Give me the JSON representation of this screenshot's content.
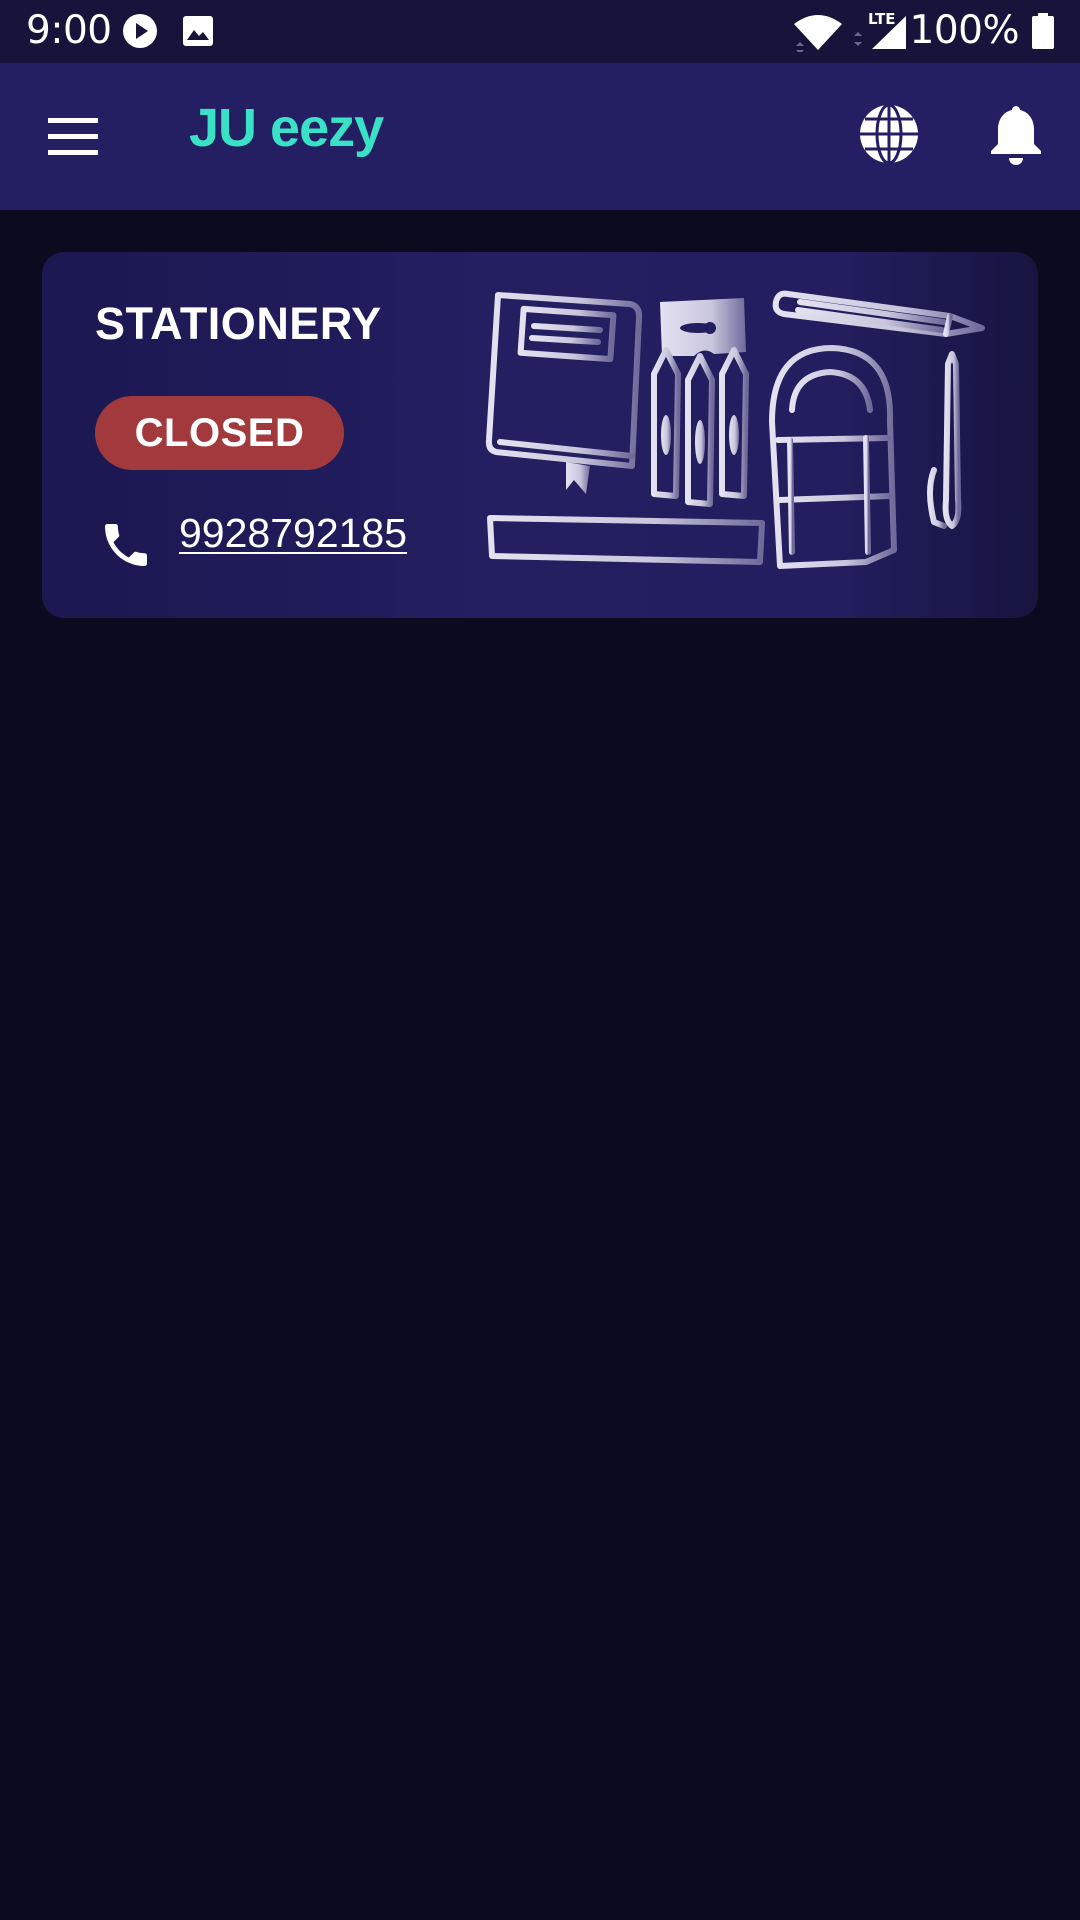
{
  "status_bar": {
    "time": "9:00",
    "battery": "100%",
    "network_label": "LTE",
    "icons": [
      "play-icon",
      "image-icon",
      "wifi-icon",
      "signal-icon",
      "battery-icon"
    ]
  },
  "app_bar": {
    "title": "JU eezy",
    "title_color": "#39e2c6",
    "background": "#231f62",
    "icons": [
      "menu-icon",
      "globe-icon",
      "bell-icon"
    ]
  },
  "store": {
    "name": "STATIONERY",
    "status": "CLOSED",
    "status_color": "#a23a3d",
    "phone": "9928792185",
    "illustration": "stationery-illustration"
  },
  "colors": {
    "page_background": "#0c0a1f",
    "status_bar_background": "#17133a"
  }
}
